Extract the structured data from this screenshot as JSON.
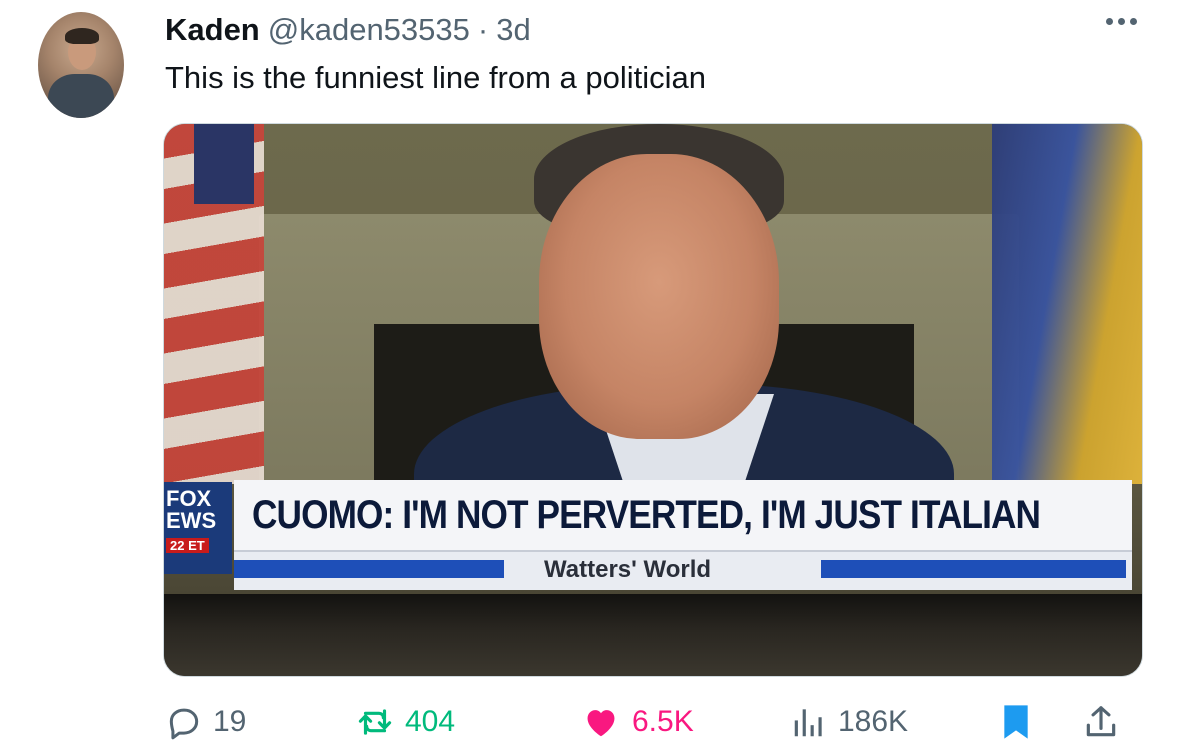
{
  "author": {
    "name": "Kaden",
    "handle": "@kaden53535",
    "separator": "·",
    "time": "3d"
  },
  "tweet": {
    "text": "This is the funniest line from a politician"
  },
  "media": {
    "network_logo": [
      "FOX",
      "EWS"
    ],
    "time_tag": "22 ET",
    "headline": "CUOMO: I'M NOT PERVERTED, I'M JUST ITALIAN",
    "show_name": "Watters' World"
  },
  "actions": {
    "replies": "19",
    "retweets": "404",
    "likes": "6.5K",
    "views": "186K"
  },
  "colors": {
    "retweet": "#00ba7c",
    "like": "#f91880",
    "bookmark": "#1d9bf0",
    "muted": "#536471"
  }
}
